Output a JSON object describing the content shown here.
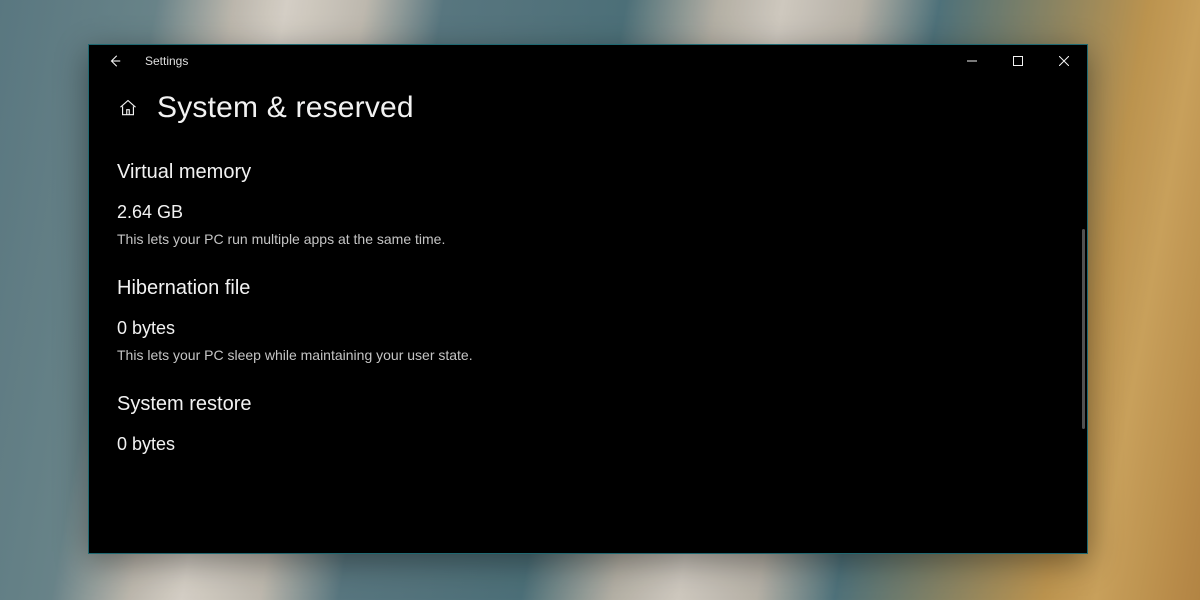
{
  "window": {
    "app_title": "Settings",
    "page_title": "System & reserved"
  },
  "sections": {
    "virtual_memory": {
      "heading": "Virtual memory",
      "value": "2.64 GB",
      "description": "This lets your PC run multiple apps at the same time."
    },
    "hibernation_file": {
      "heading": "Hibernation file",
      "value": "0 bytes",
      "description": "This lets your PC sleep while maintaining your user state."
    },
    "system_restore": {
      "heading": "System restore",
      "value": "0 bytes"
    }
  },
  "colors": {
    "window_bg": "#000000",
    "window_border": "#1a6f7a",
    "text_primary": "#ffffff",
    "text_secondary": "#cfcfcf"
  }
}
